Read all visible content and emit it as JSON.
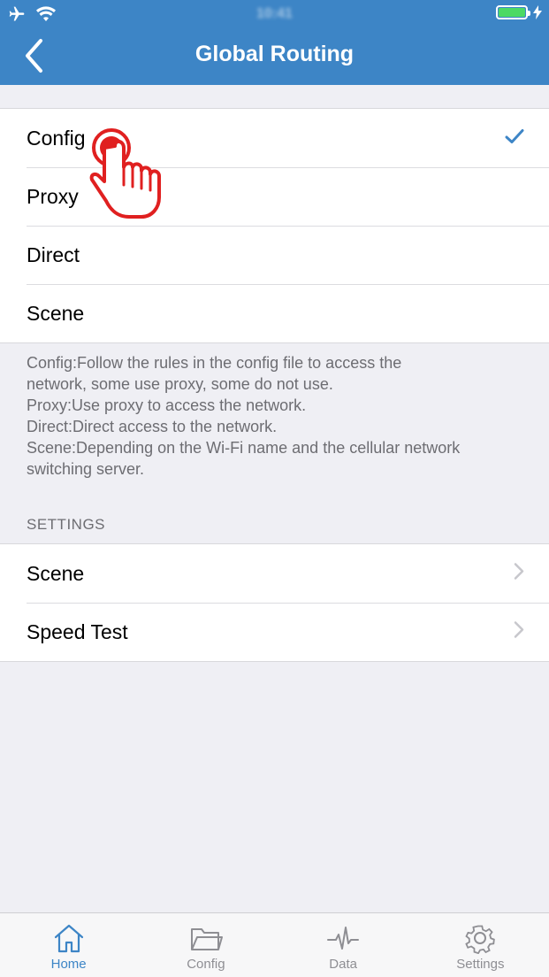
{
  "status_bar": {
    "time": "10:41"
  },
  "navbar": {
    "title": "Global Routing",
    "back_icon": "chevron-left-icon"
  },
  "routing_options": [
    {
      "label": "Config",
      "selected": true
    },
    {
      "label": "Proxy",
      "selected": false
    },
    {
      "label": "Direct",
      "selected": false
    },
    {
      "label": "Scene",
      "selected": false
    }
  ],
  "description": [
    "Config:Follow the rules in the config file to access the",
    "network, some use proxy, some do not use.",
    "Proxy:Use proxy to access the network.",
    "Direct:Direct access to the network.",
    "Scene:Depending on the Wi-Fi name and the cellular network",
    "switching server."
  ],
  "settings": {
    "header": "SETTINGS",
    "items": [
      {
        "label": "Scene"
      },
      {
        "label": "Speed Test"
      }
    ]
  },
  "tabbar": {
    "items": [
      {
        "label": "Home",
        "icon": "home-icon",
        "active": true
      },
      {
        "label": "Config",
        "icon": "folder-icon",
        "active": false
      },
      {
        "label": "Data",
        "icon": "pulse-icon",
        "active": false
      },
      {
        "label": "Settings",
        "icon": "gear-icon",
        "active": false
      }
    ]
  },
  "colors": {
    "accent": "#3d85c6",
    "background": "#efeff4",
    "battery": "#4cd964",
    "hand": "#e02020"
  }
}
